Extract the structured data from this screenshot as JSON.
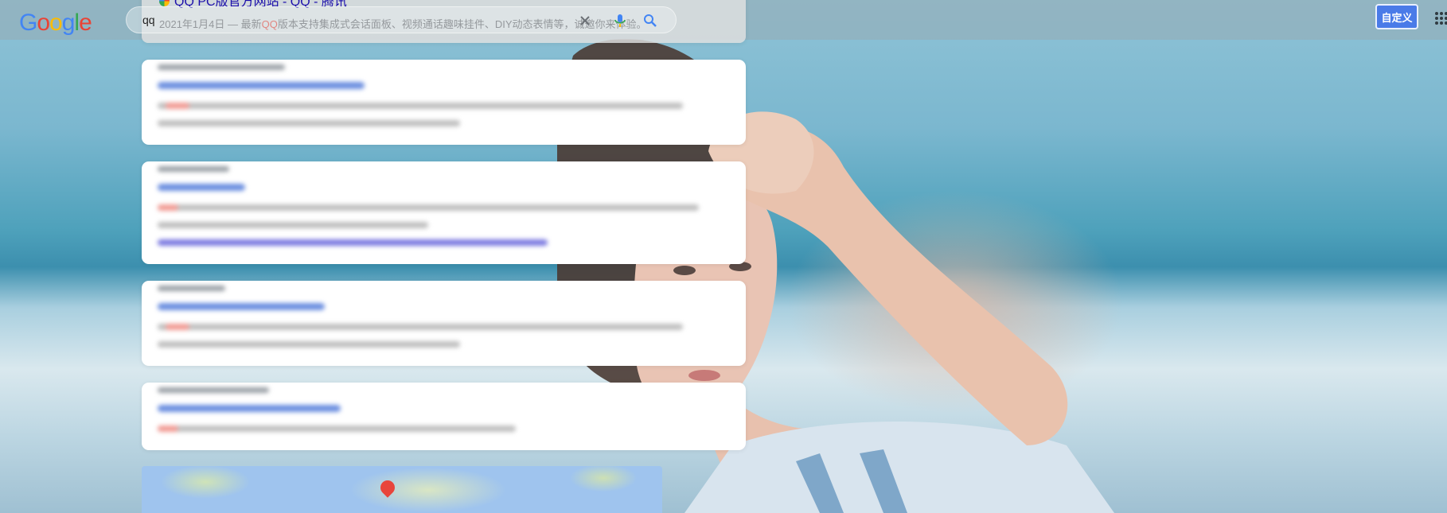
{
  "header": {
    "logo": [
      "G",
      "o",
      "o",
      "g",
      "l",
      "e"
    ],
    "logo_colors": [
      "#4285f4",
      "#ea4335",
      "#fbbc05",
      "#4285f4",
      "#34a853",
      "#ea4335"
    ],
    "search_value": "qq",
    "customize_label": "自定义"
  },
  "results": {
    "first": {
      "title": "QQ PC版官方网站 - QQ - 腾讯",
      "snippet_date": "2021年1月4日 — 最新",
      "snippet_hl": "QQ",
      "snippet_rest": "版本支持集成式会话面板、视频通话趣味挂件、DIY动态表情等，诚邀你来体验。"
    }
  },
  "colors": {
    "accent": "#4a7be8",
    "link": "#1a0dab",
    "highlight": "#d93025"
  }
}
